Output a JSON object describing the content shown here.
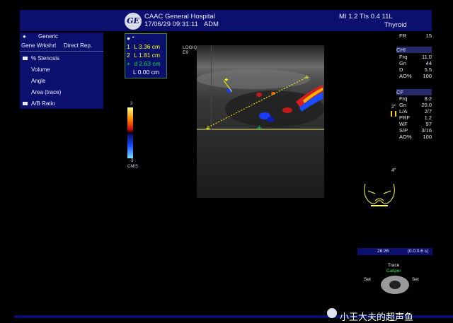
{
  "header": {
    "logo_text": "GE",
    "hospital": "CAAC General Hospital",
    "datetime": "17/06/29 09:31:11",
    "operator": "ADM",
    "mi_tis": "MI 1.2  TIs 0.4 11L",
    "preset": "Thyroid"
  },
  "menu": {
    "title": "Generic",
    "title_mark": "●",
    "worksheet": "Gene Wrkshrt",
    "report": "Direct Rep.",
    "items": [
      {
        "label": "% Stenosis",
        "icon": "folder-icon"
      },
      {
        "label": "Volume"
      },
      {
        "label": "Angle"
      },
      {
        "label": "Area (trace)"
      },
      {
        "label": "A/B Ratio",
        "icon": "folder-icon"
      }
    ]
  },
  "measurements": {
    "header_mark": "● *",
    "rows": [
      {
        "marker": "1",
        "text": "L  3.36 cm",
        "color": "#ffff00"
      },
      {
        "marker": "2",
        "text": "L  1.81 cm",
        "color": "#ffff00"
      },
      {
        "marker": "+",
        "text": "d  2.63 cm",
        "color": "#00e040"
      },
      {
        "marker": "",
        "text": "L  0.00 cm",
        "color": "#ffffff"
      }
    ]
  },
  "colorbar": {
    "top": "3",
    "bottom": "-3",
    "unit": "CM/S"
  },
  "probe_label": {
    "line1": "LOGIQ",
    "line2": "E9"
  },
  "params": {
    "fr_label": "FR",
    "fr_value": "15",
    "chi_header": "CHI",
    "chi": [
      {
        "label": "Frq",
        "value": "11.0"
      },
      {
        "label": "Gn",
        "value": "44"
      },
      {
        "label": "D",
        "value": "5.5"
      },
      {
        "label": "AO%",
        "value": "100"
      }
    ],
    "cf_header": "CF",
    "cf": [
      {
        "label": "Frq",
        "value": "8.2"
      },
      {
        "label": "Gn",
        "value": "20.0"
      },
      {
        "label": "L/A",
        "value": "2/7"
      },
      {
        "label": "PRF",
        "value": "1.2"
      },
      {
        "label": "WF",
        "value": "97"
      },
      {
        "label": "S/P",
        "value": "3/16"
      },
      {
        "label": "AO%",
        "value": "100"
      }
    ]
  },
  "depth_marks": {
    "upper": "2\"",
    "lower": "4\""
  },
  "trace_bar": {
    "left": "26:26",
    "right": "(0.0:0.6 s)"
  },
  "controls": {
    "top": "Trace",
    "center": "Caliper",
    "left": "Set",
    "right": "Set"
  },
  "watermark": "小王大夫的超声鱼"
}
